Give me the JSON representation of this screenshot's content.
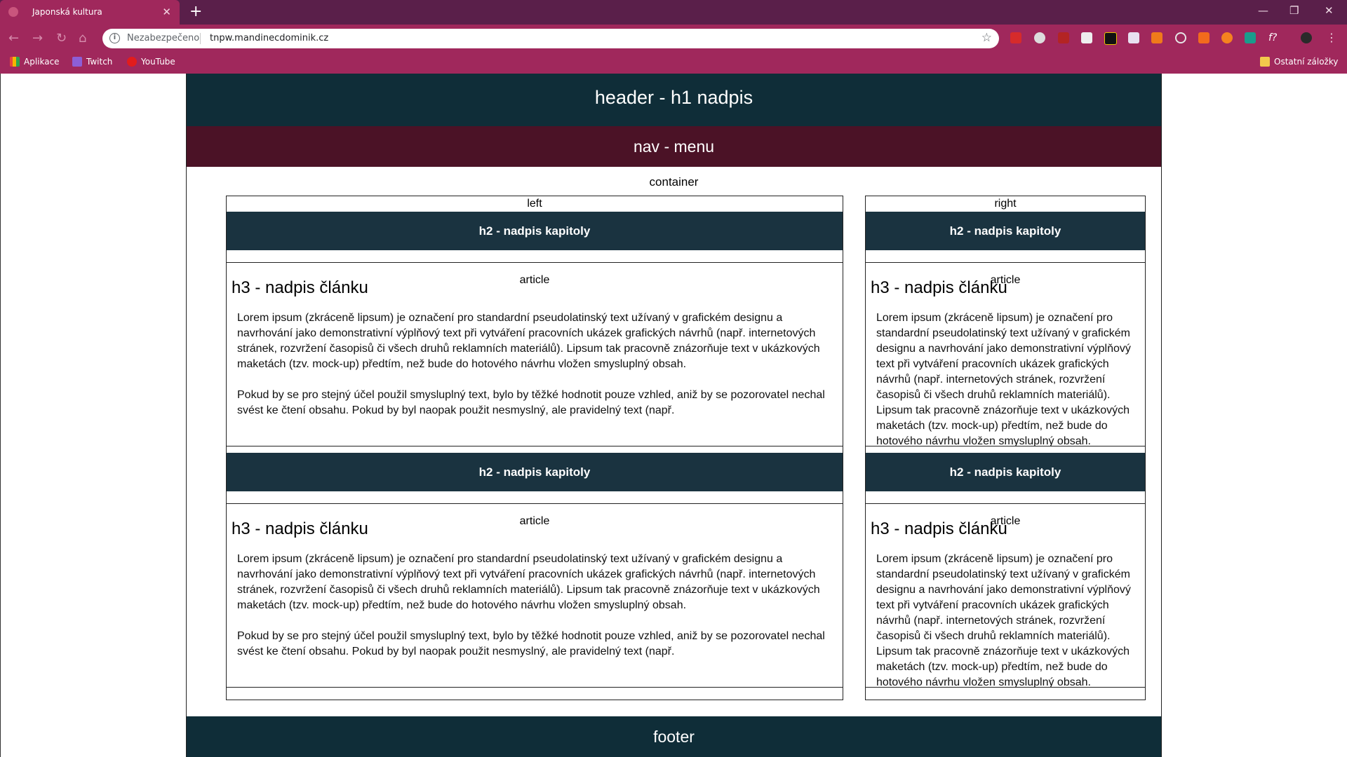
{
  "browser": {
    "tab_title": "Japonská kultura",
    "tab_close": "✕",
    "new_tab": "+",
    "window_controls": {
      "minimize": "—",
      "restore": "❐",
      "close": "✕"
    },
    "nav": {
      "back": "←",
      "forward": "→",
      "reload": "↻",
      "home": "⌂"
    },
    "security_label": "Nezabezpečeno",
    "url": "tnpw.mandinecdominik.cz",
    "bookmark_star": "☆",
    "bookmarks": [
      "Aplikace",
      "Twitch",
      "YouTube"
    ],
    "other_bookmarks": "Ostatní záložky",
    "colors": {
      "tabbar": "#5a1f4a",
      "toolbar": "#a0285c"
    }
  },
  "page": {
    "header": "header - h1 nadpis",
    "nav": "nav - menu",
    "container": "container",
    "left_label": "left",
    "right_label": "right",
    "h2": "h2 - nadpis kapitoly",
    "article_label": "article",
    "h3": "h3 - nadpis článku",
    "paragraph1": "Lorem ipsum (zkráceně lipsum) je označení pro standardní pseudolatinský text užívaný v grafickém designu a navrhování jako demonstrativní výplňový text při vytváření pracovních ukázek grafických návrhů (např. internetových stránek, rozvržení časopisů či všech druhů reklamních materiálů). Lipsum tak pracovně znázorňuje text v ukázkových maketách (tzv. mock-up) předtím, než bude do hotového návrhu vložen smysluplný obsah.",
    "paragraph2": "Pokud by se pro stejný účel použil smysluplný text, bylo by těžké hodnotit pouze vzhled, aniž by se pozorovatel nechal svést ke čtení obsahu. Pokud by byl naopak použit nesmyslný, ale pravidelný text (např.",
    "footer": "footer",
    "colors": {
      "header": "#0f2d38",
      "nav": "#4b1226",
      "h2": "#1a3340"
    }
  }
}
